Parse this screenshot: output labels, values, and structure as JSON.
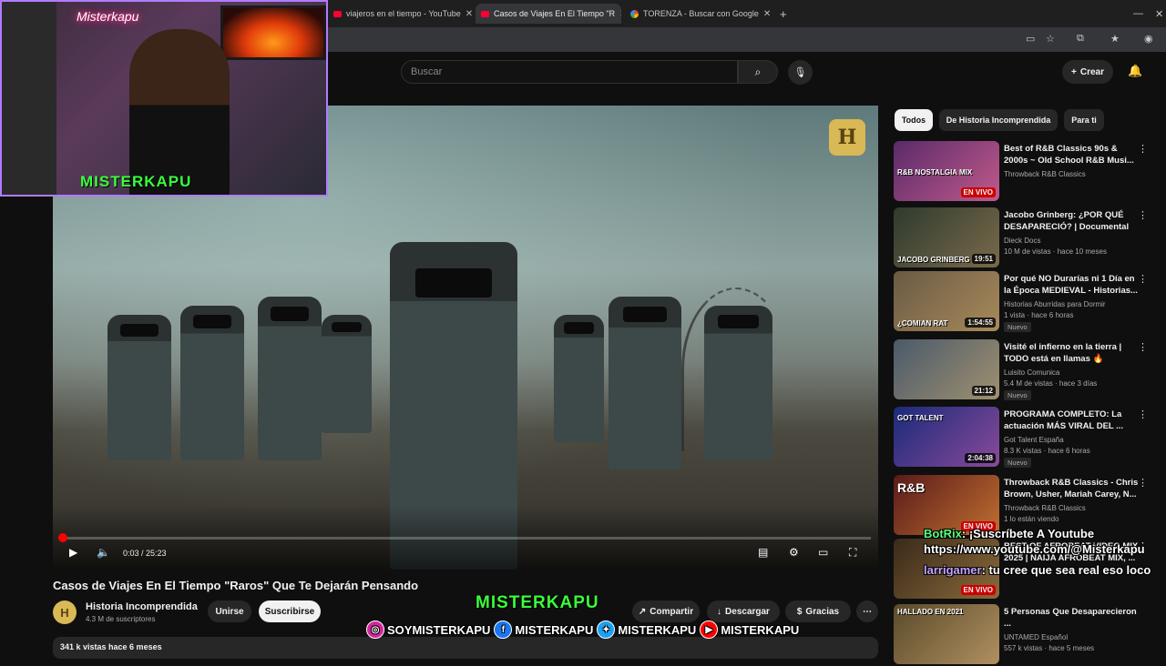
{
  "browser": {
    "tabs": [
      {
        "title": "viajeros en el tiempo - YouTube",
        "icon": "youtube-icon"
      },
      {
        "title": "Casos de Viajes En El Tiempo \"R",
        "icon": "youtube-icon"
      },
      {
        "title": "TORENZA - Buscar con Google",
        "icon": "google-icon"
      }
    ],
    "new_tab": "+"
  },
  "header": {
    "search_placeholder": "Buscar",
    "create_label": "Crear"
  },
  "webcam": {
    "neon_sign": "Misterkapu",
    "name_tag": "MISTERKAPU"
  },
  "player": {
    "time": "0:03 / 25:23",
    "progress": 0.002,
    "channel_logo_letter": "H"
  },
  "video": {
    "title": "Casos de Viajes En El Tiempo \"Raros\" Que Te Dejarán Pensando",
    "channel": "Historia Incomprendida",
    "subscribers": "4.3 M de suscriptores",
    "join": "Unirse",
    "subscribe": "Suscribirse",
    "share": "Compartir",
    "download": "Descargar",
    "thanks": "Gracias",
    "meta": "341 k vistas  hace 6 meses"
  },
  "overlay": {
    "brand": "MISTERKAPU",
    "socials": [
      {
        "handle": "SOYMISTERKAPU",
        "icon": "instagram-icon",
        "color": "#d6249f"
      },
      {
        "handle": "MISTERKAPU",
        "icon": "facebook-icon",
        "color": "#1877f2"
      },
      {
        "handle": "MISTERKAPU",
        "icon": "twitter-icon",
        "color": "#1da1f2"
      },
      {
        "handle": "MISTERKAPU",
        "icon": "youtube-icon",
        "color": "#ff0000"
      }
    ]
  },
  "chips": [
    "Todos",
    "De Historia Incomprendida",
    "Para ti"
  ],
  "recommendations": [
    {
      "title": "Best of R&B Classics 90s & 2000s ~ Old School R&B Musi...",
      "channel": "Throwback R&B Classics",
      "meta": "",
      "badge": "EN VIVO",
      "thumb_text": "R&B NOSTALGIA MIX",
      "thumb_color": "#5a2a6a"
    },
    {
      "title": "Jacobo Grinberg: ¿POR QUÉ DESAPARECIÓ? | Documental",
      "channel": "Dieck Docs",
      "meta": "10 M de vistas · hace 10 meses",
      "duration": "19:51",
      "thumb_text": "JACOBO GRINBERG",
      "thumb_color": "#3a4a3a"
    },
    {
      "title": "Por qué NO Durarías ni 1 Día en la Época MEDIEVAL - Historias...",
      "channel": "Historias Aburridas para Dormir",
      "meta": "1 vista · hace 6 horas",
      "tag": "Nuevo",
      "duration": "1:54:55",
      "thumb_text": "¿COMIAN RAT",
      "thumb_color": "#6a5a44"
    },
    {
      "title": "Visité el infierno en la tierra | TODO está en llamas 🔥",
      "channel": "Luisito Comunica",
      "meta": "5.4 M de vistas · hace 3 días",
      "tag": "Nuevo",
      "duration": "21:12",
      "thumb_text": "",
      "thumb_color": "#5a6a7a"
    },
    {
      "title": "PROGRAMA COMPLETO: La actuación MÁS VIRAL DEL ...",
      "channel": "Got Talent España",
      "meta": "8.3 K vistas · hace 6 horas",
      "tag": "Nuevo",
      "duration": "2:04:38",
      "thumb_text": "GOT TALENT",
      "thumb_color": "#2a3a8a"
    },
    {
      "title": "Throwback R&B Classics - Chris Brown, Usher, Mariah Carey, N...",
      "channel": "Throwback R&B Classics",
      "meta": "1 lo están viendo",
      "badge": "EN VIVO",
      "thumb_text": "R&B",
      "thumb_color": "#7a2a2a"
    },
    {
      "title": "BEST OF AFROBEAT VIDEO MIX 2025 | NAIJA AFROBEAT MIX, ...",
      "channel": "",
      "meta": "",
      "badge": "EN VIVO",
      "thumb_text": "",
      "thumb_color": "#4a3a2a"
    },
    {
      "title": "5 Personas Que Desaparecieron ...",
      "channel": "UNTAMED Español",
      "meta": "557 k vistas · hace 5 meses",
      "thumb_text": "HALLADO EN 2021",
      "thumb_color": "#6a5a3a"
    }
  ],
  "chat": [
    {
      "user": "BotRix",
      "message": ": ¡Suscríbete A Youtube https://www.youtube.com/@Misterkapu"
    },
    {
      "user": "larrigamer",
      "message": ": tu cree que sea real eso loco"
    }
  ]
}
